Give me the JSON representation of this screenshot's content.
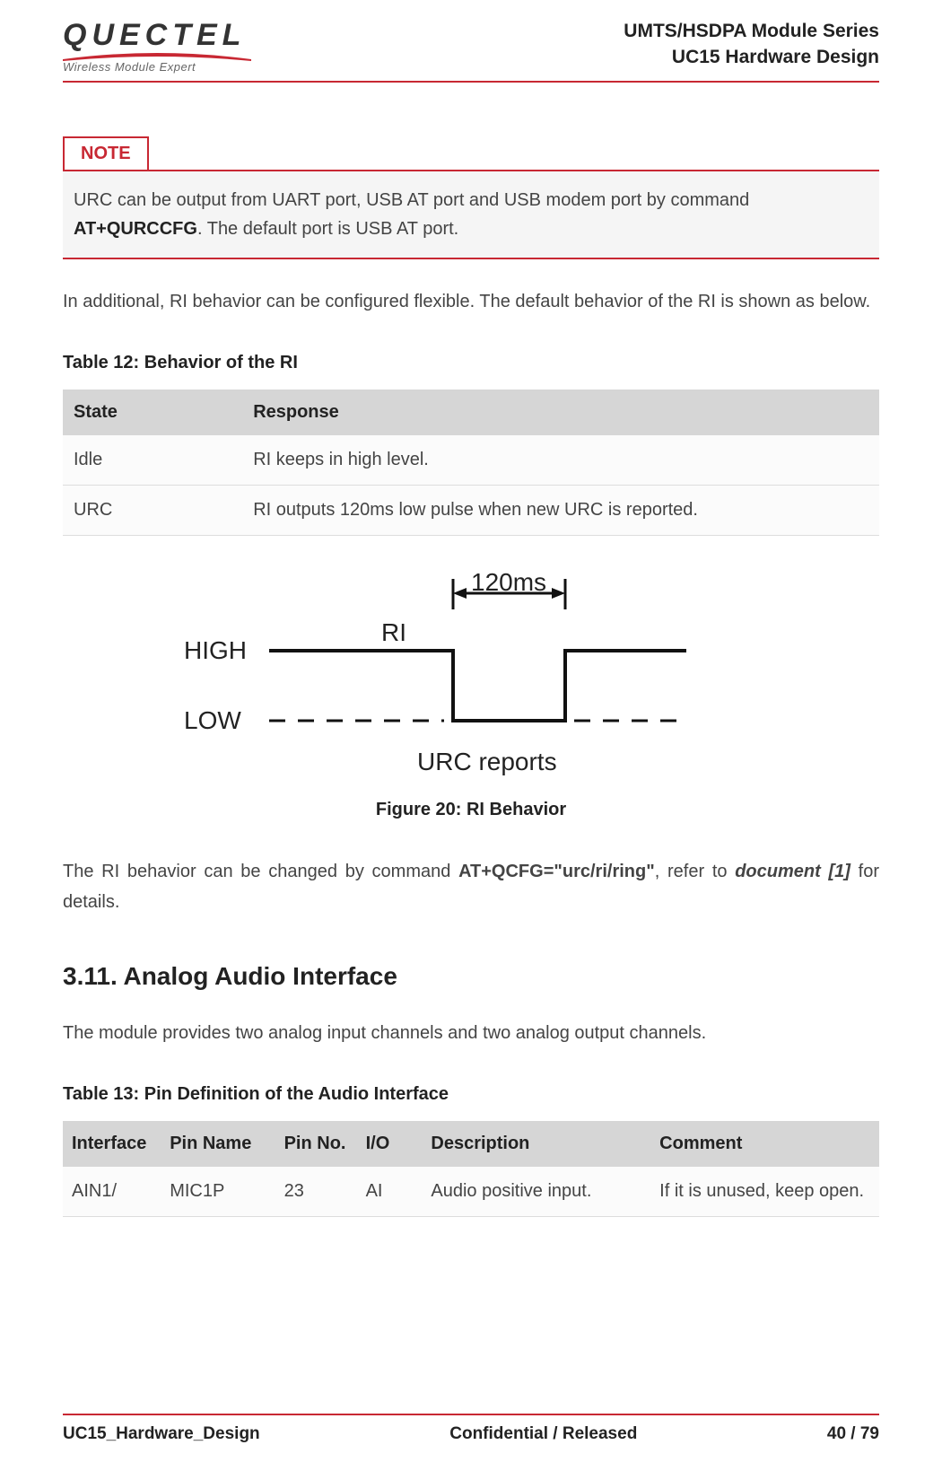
{
  "header": {
    "brand": "QUECTEL",
    "tagline": "Wireless Module Expert",
    "series": "UMTS/HSDPA Module Series",
    "doc_title": "UC15 Hardware Design"
  },
  "note": {
    "label": "NOTE",
    "body_pre": "URC can be output from UART port, USB AT port and USB modem port by command ",
    "body_cmd": "AT+QURCCFG",
    "body_post": ". The default port is USB AT port."
  },
  "p_additional": "In additional, RI behavior can be configured flexible. The default behavior of the RI is shown as below.",
  "table12": {
    "caption": "Table 12: Behavior of the RI",
    "headers": {
      "state": "State",
      "response": "Response"
    },
    "rows": [
      {
        "state": "Idle",
        "response": "RI keeps in high level."
      },
      {
        "state": "URC",
        "response": "RI outputs 120ms low pulse when new URC is reported."
      }
    ]
  },
  "figure": {
    "labels": {
      "t120": "120ms",
      "ri": "RI",
      "high": "HIGH",
      "low": "LOW",
      "urc": "URC reports"
    },
    "caption": "Figure 20: RI Behavior"
  },
  "p_ri_change_pre": "The RI behavior can be changed by command ",
  "p_ri_change_cmd": "AT+QCFG=\"urc/ri/ring\"",
  "p_ri_change_mid": ", refer to ",
  "p_ri_change_ref": "document [1]",
  "p_ri_change_post": " for details.",
  "section311": "3.11. Analog Audio Interface",
  "p_audio_intro": "The module provides two analog input channels and two analog output channels.",
  "table13": {
    "caption": "Table 13: Pin Definition of the Audio Interface",
    "headers": {
      "interface": "Interface",
      "pin_name": "Pin Name",
      "pin_no": "Pin No.",
      "io": "I/O",
      "description": "Description",
      "comment": "Comment"
    },
    "rows": [
      {
        "interface": "AIN1/",
        "pin_name": "MIC1P",
        "pin_no": "23",
        "io": "AI",
        "description": "Audio positive input.",
        "comment": "If it is unused, keep open."
      }
    ]
  },
  "footer": {
    "left": "UC15_Hardware_Design",
    "center": "Confidential / Released",
    "right": "40 / 79"
  }
}
